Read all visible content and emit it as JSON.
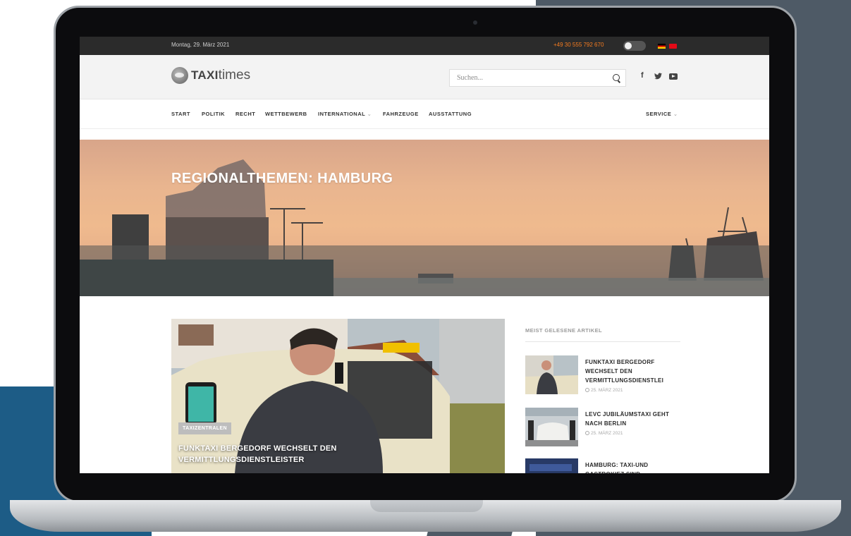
{
  "topbar": {
    "date": "Montag, 29. März 2021",
    "phone": "+49 30 555 792 670"
  },
  "header": {
    "logo_bold": "TAXI",
    "logo_light": "times",
    "search_placeholder": "Suchen...",
    "social": {
      "facebook": "f",
      "twitter": "t"
    }
  },
  "nav": {
    "items": [
      "START",
      "POLITIK",
      "RECHT",
      "WETTBEWERB",
      "INTERNATIONAL",
      "FAHRZEUGE",
      "AUSSTATTUNG"
    ],
    "right": "SERVICE",
    "caret": "⌄"
  },
  "hero": {
    "title": "REGIONALTHEMEN: HAMBURG"
  },
  "feature": {
    "badge": "TAXIZENTRALEN",
    "title": "FUNKTAXI BERGEDORF WECHSELT DEN VERMITTLUNGSDIENSTLEISTER"
  },
  "sidebar": {
    "heading": "MEIST GELESENE ARTIKEL",
    "items": [
      {
        "title": "FUNKTAXI BERGEDORF WECHSELT DEN VERMITTLUNGSDIENSTLEI",
        "date": "25. MÄRZ 2021"
      },
      {
        "title": "LEVC JUBILÄUMSTAXI GEHT NACH BERLIN",
        "date": "25. MÄRZ 2021"
      },
      {
        "title": "HAMBURG: TAXI-UND GASTROKIEZ SIND",
        "date": ""
      }
    ]
  },
  "colors": {
    "accent_orange": "#f47b20",
    "topbar": "#2b2b2b",
    "header_bg": "#f3f3f3"
  }
}
